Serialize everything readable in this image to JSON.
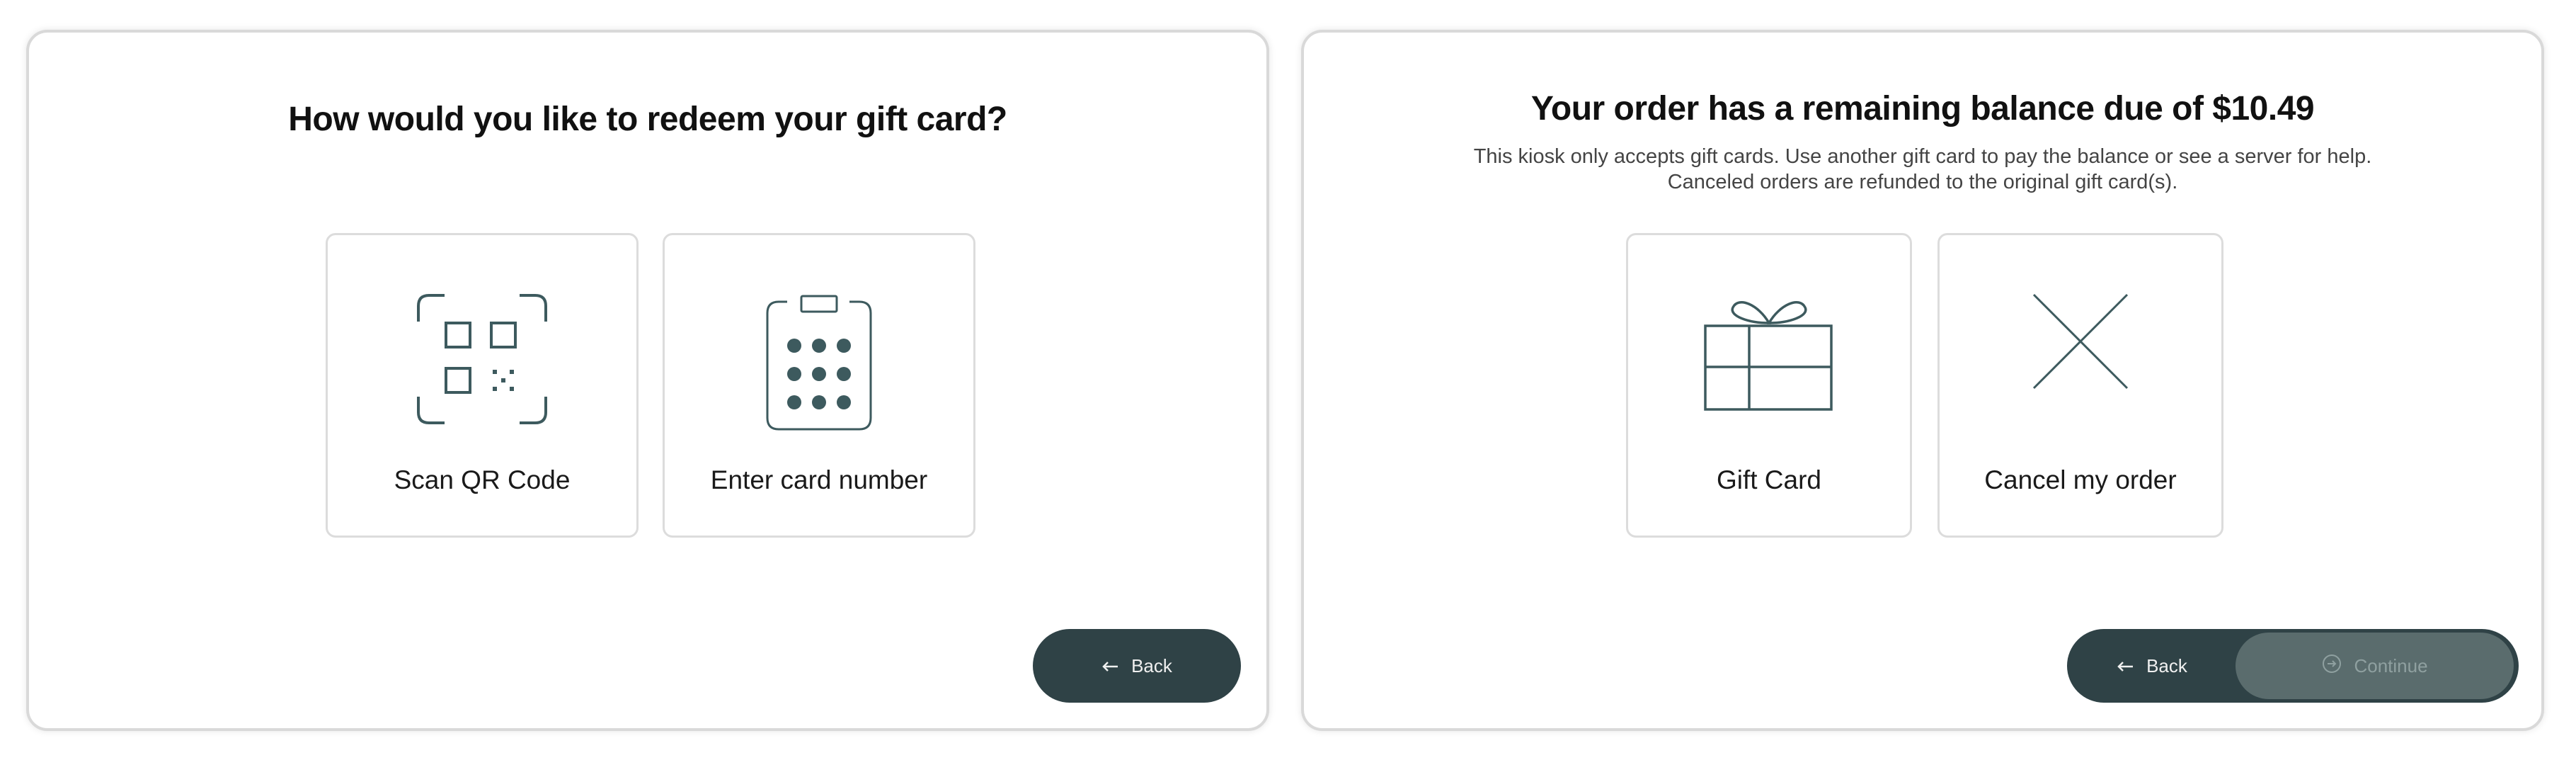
{
  "left_screen": {
    "title": "How would you like to redeem your gift card?",
    "options": [
      {
        "label": "Scan QR Code",
        "icon": "qr-code-icon"
      },
      {
        "label": "Enter card number",
        "icon": "keypad-icon"
      }
    ],
    "back_label": "Back"
  },
  "right_screen": {
    "title": "Your order has a remaining balance due of $10.49",
    "subtitle_line1": "This kiosk only accepts gift cards. Use another gift card to pay the balance or see a server for help.",
    "subtitle_line2": "Canceled orders are refunded to the original gift card(s).",
    "options": [
      {
        "label": "Gift Card",
        "icon": "gift-icon"
      },
      {
        "label": "Cancel my order",
        "icon": "close-icon"
      }
    ],
    "back_label": "Back",
    "continue_label": "Continue"
  },
  "colors": {
    "button_dark": "#2f4246",
    "button_disabled": "#5a6c6d",
    "icon_color": "#3d5a5e"
  }
}
